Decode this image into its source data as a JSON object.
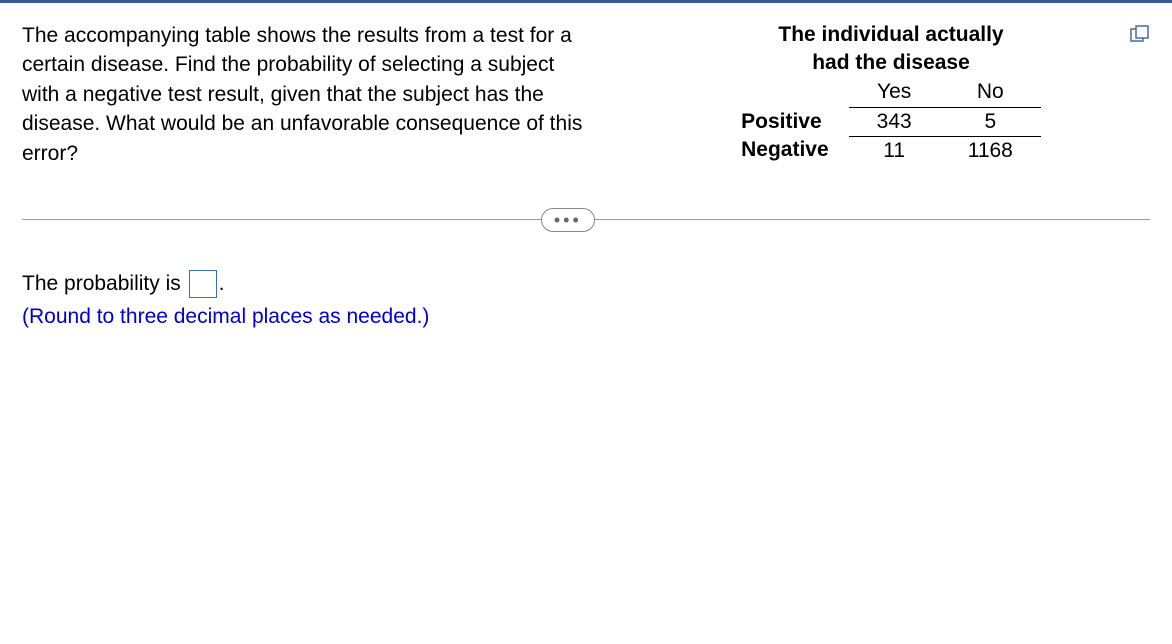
{
  "question": {
    "text": "The accompanying table shows the results from a test for a certain disease. Find the probability of selecting a subject with a negative test result, given that the subject has the disease. What would be an unfavorable consequence of this error?"
  },
  "table": {
    "title_line1": "The individual actually",
    "title_line2": "had the disease",
    "col1": "Yes",
    "col2": "No",
    "row1_label": "Positive",
    "row1_val1": "343",
    "row1_val2": "5",
    "row2_label": "Negative",
    "row2_val1": "11",
    "row2_val2": "1168"
  },
  "divider": {
    "dots": "•••"
  },
  "answer": {
    "prefix": "The probability is ",
    "suffix": ".",
    "hint": "(Round to three decimal places as needed.)"
  },
  "chart_data": {
    "type": "table",
    "title": "The individual actually had the disease",
    "columns": [
      "",
      "Yes",
      "No"
    ],
    "rows": [
      [
        "Positive",
        343,
        5
      ],
      [
        "Negative",
        11,
        1168
      ]
    ]
  }
}
